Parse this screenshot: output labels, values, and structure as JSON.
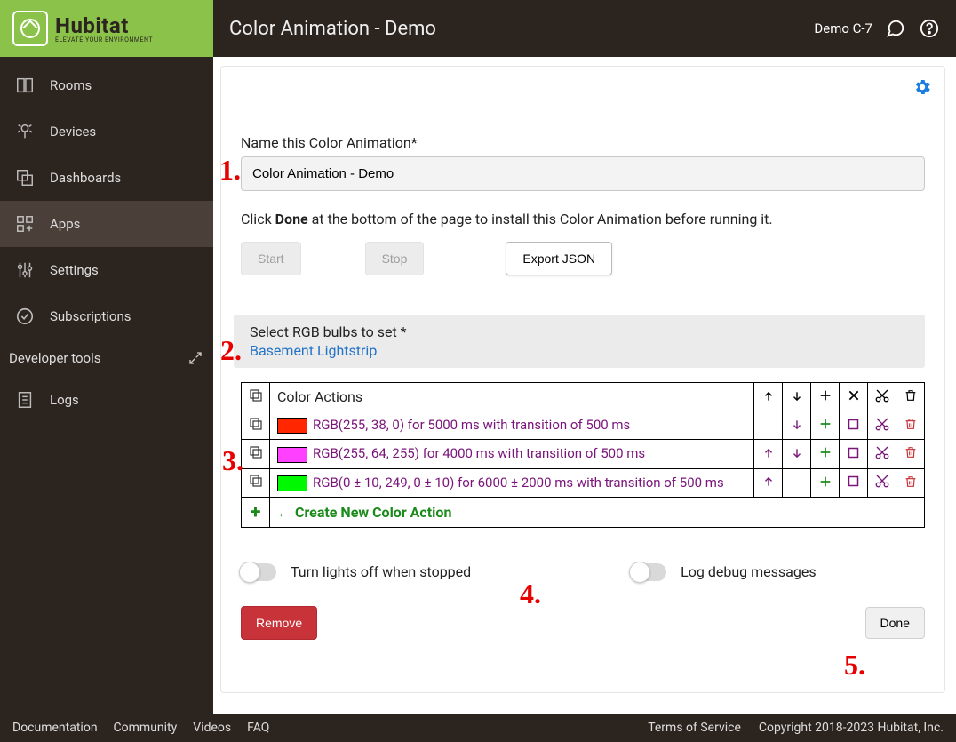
{
  "brand": {
    "name": "Hubitat",
    "tagline": "ELEVATE YOUR ENVIRONMENT"
  },
  "header": {
    "title": "Color Animation - Demo",
    "hub_name": "Demo C-7"
  },
  "sidebar": {
    "items": [
      {
        "label": "Rooms"
      },
      {
        "label": "Devices"
      },
      {
        "label": "Dashboards"
      },
      {
        "label": "Apps"
      },
      {
        "label": "Settings"
      },
      {
        "label": "Subscriptions"
      }
    ],
    "dev_tools": "Developer tools",
    "logs": "Logs"
  },
  "form": {
    "name_label": "Name this Color Animation*",
    "name_value": "Color Animation - Demo",
    "instruction_pre": "Click ",
    "instruction_bold": "Done",
    "instruction_post": " at the bottom of the page to install this Color Animation before running it.",
    "start": "Start",
    "stop": "Stop",
    "export": "Export JSON",
    "select_label": "Select RGB bulbs to set *",
    "select_value": "Basement Lightstrip"
  },
  "table": {
    "header": "Color Actions",
    "rows": [
      {
        "color": "#ff2600",
        "text": "RGB(255, 38, 0) for 5000 ms with transition of 500 ms",
        "up": false,
        "down": true
      },
      {
        "color": "#ff40ff",
        "text": "RGB(255, 64, 255) for 4000 ms with transition of 500 ms",
        "up": true,
        "down": true
      },
      {
        "color": "#00f900",
        "text": "RGB(0 ± 10, 249, 0 ± 10) for 6000 ± 2000 ms with transition of 500 ms",
        "up": true,
        "down": false
      }
    ],
    "icons": {
      "plus_color": "#1a8a1a",
      "box_color": "#7a157a",
      "cut_color": "#7a157a",
      "trash_color": "#c8333a",
      "arrow_color": "#7a157a"
    },
    "create": "Create New Color Action"
  },
  "toggles": {
    "off_when_stopped": "Turn lights off when stopped",
    "debug": "Log debug messages"
  },
  "buttons": {
    "remove": "Remove",
    "done": "Done"
  },
  "footer": {
    "links": [
      "Documentation",
      "Community",
      "Videos",
      "FAQ"
    ],
    "tos": "Terms of Service",
    "copyright": "Copyright 2018-2023 Hubitat, Inc."
  },
  "annotations": [
    "1.",
    "2.",
    "3.",
    "4.",
    "5."
  ]
}
